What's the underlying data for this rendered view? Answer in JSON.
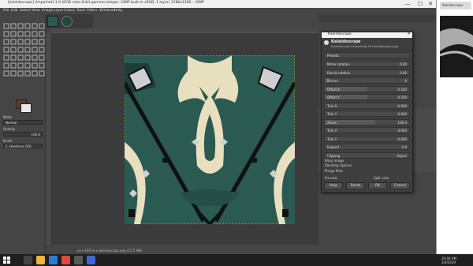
{
  "window": {
    "title": "[kaleidoscope] (imported)-1.0 (RGB color 8-bit gamma integer, GIMP built-in sRGB, 1 layer) 1280x1280 – GIMP",
    "minimize": "—",
    "maximize": "☐",
    "close": "✕"
  },
  "menu": [
    "File",
    "Edit",
    "Select",
    "View",
    "Image",
    "Layer",
    "Colors",
    "Tools",
    "Filters",
    "Windows",
    "Help"
  ],
  "tool_options": {
    "mode_label": "Mode",
    "mode_value": "Normal",
    "opacity_label": "Opacity",
    "opacity_value": "100.0",
    "brush_label": "Brush",
    "brush_value": "2. Hardness 050"
  },
  "status": {
    "text": "px ▾  100 % ▾  kaleidoscope.png (21.5 MB)"
  },
  "dialog": {
    "title": "Kaleidoscope",
    "close": "✕",
    "header_title": "Kaleidoscope",
    "header_sub": "[kaleidoscope] (imported)-50 (kaleidoscope.png)",
    "presets_label": "Presets:",
    "rows": [
      {
        "label": "Mirror rotation",
        "value": "0.00",
        "fill": 0.0
      },
      {
        "label": "Result rotation",
        "value": "0.00",
        "fill": 0.0
      },
      {
        "label": "Mirrors",
        "value": "6",
        "fill": 0.05
      },
      {
        "label": "Offset X",
        "value": "0.500",
        "fill": 0.5
      },
      {
        "label": "Offset Y",
        "value": "0.500",
        "fill": 0.5
      },
      {
        "label": "Trim X",
        "value": "0.000",
        "fill": 0.0
      },
      {
        "label": "Trim Y",
        "value": "0.000",
        "fill": 0.0
      },
      {
        "label": "Zoom",
        "value": "100.0",
        "fill": 0.6
      },
      {
        "label": "Trim X",
        "value": "0.000",
        "fill": 0.0
      },
      {
        "label": "Trim Y",
        "value": "0.000",
        "fill": 0.0
      },
      {
        "label": "Expand",
        "value": "0.0",
        "fill": 0.0
      },
      {
        "label": "Clipping",
        "value": "Adjust",
        "fill": 0.0
      }
    ],
    "check1": "Warp image",
    "check2": "Blending Options",
    "check3": "Merge filter",
    "check4": "Preview",
    "check5": "Split view",
    "buttons": {
      "help": "Help",
      "reset": "Reset",
      "ok": "OK",
      "cancel": "Cancel"
    }
  },
  "dock": {
    "tab_label": "Tool Options",
    "layers_label": "Layers",
    "mode_label": "Mode",
    "opacity_label": "Opacity"
  },
  "browser": {
    "tab_label": "Kaleidoscope"
  },
  "taskbar": {
    "time": "10:04 AM",
    "date": "3/4/2019"
  },
  "colors": {
    "art_bg": "#2b5a52",
    "art_cream": "#e8dfbf",
    "art_black": "#111111",
    "fg": "#5a3d2b",
    "bg": "#e8e8e8"
  }
}
